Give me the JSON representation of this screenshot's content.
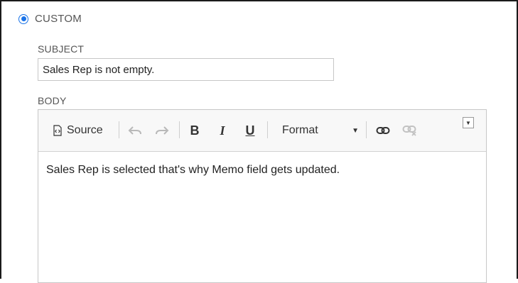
{
  "option": {
    "label": "CUSTOM",
    "selected": true
  },
  "subject": {
    "label": "SUBJECT",
    "value": "Sales Rep is not empty."
  },
  "body": {
    "label": "BODY",
    "toolbar": {
      "source_label": "Source",
      "format_label": "Format"
    },
    "content": "Sales Rep is selected that's why Memo field gets updated."
  },
  "colors": {
    "accent": "#1a73e8",
    "label": "#555555",
    "border": "#c7c7c7",
    "toolbar_bg": "#f8f8f8"
  }
}
